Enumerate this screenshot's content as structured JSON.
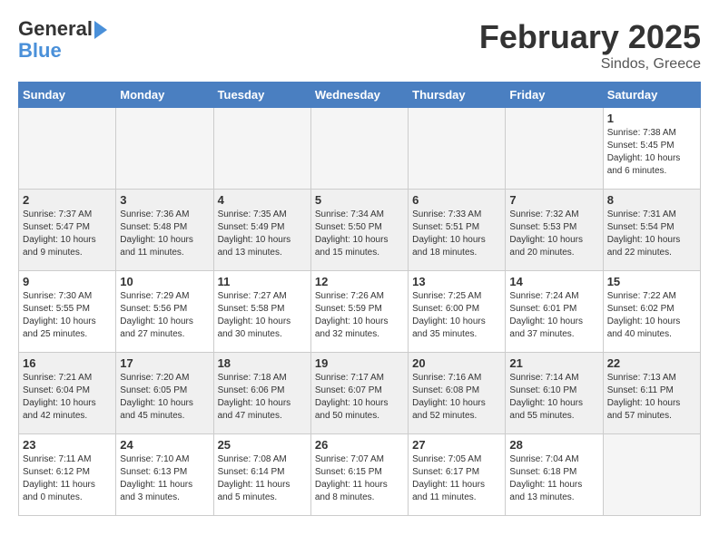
{
  "header": {
    "logo_line1": "General",
    "logo_line2": "Blue",
    "month": "February 2025",
    "location": "Sindos, Greece"
  },
  "weekdays": [
    "Sunday",
    "Monday",
    "Tuesday",
    "Wednesday",
    "Thursday",
    "Friday",
    "Saturday"
  ],
  "weeks": [
    [
      {
        "day": "",
        "info": ""
      },
      {
        "day": "",
        "info": ""
      },
      {
        "day": "",
        "info": ""
      },
      {
        "day": "",
        "info": ""
      },
      {
        "day": "",
        "info": ""
      },
      {
        "day": "",
        "info": ""
      },
      {
        "day": "1",
        "info": "Sunrise: 7:38 AM\nSunset: 5:45 PM\nDaylight: 10 hours and 6 minutes."
      }
    ],
    [
      {
        "day": "2",
        "info": "Sunrise: 7:37 AM\nSunset: 5:47 PM\nDaylight: 10 hours and 9 minutes."
      },
      {
        "day": "3",
        "info": "Sunrise: 7:36 AM\nSunset: 5:48 PM\nDaylight: 10 hours and 11 minutes."
      },
      {
        "day": "4",
        "info": "Sunrise: 7:35 AM\nSunset: 5:49 PM\nDaylight: 10 hours and 13 minutes."
      },
      {
        "day": "5",
        "info": "Sunrise: 7:34 AM\nSunset: 5:50 PM\nDaylight: 10 hours and 15 minutes."
      },
      {
        "day": "6",
        "info": "Sunrise: 7:33 AM\nSunset: 5:51 PM\nDaylight: 10 hours and 18 minutes."
      },
      {
        "day": "7",
        "info": "Sunrise: 7:32 AM\nSunset: 5:53 PM\nDaylight: 10 hours and 20 minutes."
      },
      {
        "day": "8",
        "info": "Sunrise: 7:31 AM\nSunset: 5:54 PM\nDaylight: 10 hours and 22 minutes."
      }
    ],
    [
      {
        "day": "9",
        "info": "Sunrise: 7:30 AM\nSunset: 5:55 PM\nDaylight: 10 hours and 25 minutes."
      },
      {
        "day": "10",
        "info": "Sunrise: 7:29 AM\nSunset: 5:56 PM\nDaylight: 10 hours and 27 minutes."
      },
      {
        "day": "11",
        "info": "Sunrise: 7:27 AM\nSunset: 5:58 PM\nDaylight: 10 hours and 30 minutes."
      },
      {
        "day": "12",
        "info": "Sunrise: 7:26 AM\nSunset: 5:59 PM\nDaylight: 10 hours and 32 minutes."
      },
      {
        "day": "13",
        "info": "Sunrise: 7:25 AM\nSunset: 6:00 PM\nDaylight: 10 hours and 35 minutes."
      },
      {
        "day": "14",
        "info": "Sunrise: 7:24 AM\nSunset: 6:01 PM\nDaylight: 10 hours and 37 minutes."
      },
      {
        "day": "15",
        "info": "Sunrise: 7:22 AM\nSunset: 6:02 PM\nDaylight: 10 hours and 40 minutes."
      }
    ],
    [
      {
        "day": "16",
        "info": "Sunrise: 7:21 AM\nSunset: 6:04 PM\nDaylight: 10 hours and 42 minutes."
      },
      {
        "day": "17",
        "info": "Sunrise: 7:20 AM\nSunset: 6:05 PM\nDaylight: 10 hours and 45 minutes."
      },
      {
        "day": "18",
        "info": "Sunrise: 7:18 AM\nSunset: 6:06 PM\nDaylight: 10 hours and 47 minutes."
      },
      {
        "day": "19",
        "info": "Sunrise: 7:17 AM\nSunset: 6:07 PM\nDaylight: 10 hours and 50 minutes."
      },
      {
        "day": "20",
        "info": "Sunrise: 7:16 AM\nSunset: 6:08 PM\nDaylight: 10 hours and 52 minutes."
      },
      {
        "day": "21",
        "info": "Sunrise: 7:14 AM\nSunset: 6:10 PM\nDaylight: 10 hours and 55 minutes."
      },
      {
        "day": "22",
        "info": "Sunrise: 7:13 AM\nSunset: 6:11 PM\nDaylight: 10 hours and 57 minutes."
      }
    ],
    [
      {
        "day": "23",
        "info": "Sunrise: 7:11 AM\nSunset: 6:12 PM\nDaylight: 11 hours and 0 minutes."
      },
      {
        "day": "24",
        "info": "Sunrise: 7:10 AM\nSunset: 6:13 PM\nDaylight: 11 hours and 3 minutes."
      },
      {
        "day": "25",
        "info": "Sunrise: 7:08 AM\nSunset: 6:14 PM\nDaylight: 11 hours and 5 minutes."
      },
      {
        "day": "26",
        "info": "Sunrise: 7:07 AM\nSunset: 6:15 PM\nDaylight: 11 hours and 8 minutes."
      },
      {
        "day": "27",
        "info": "Sunrise: 7:05 AM\nSunset: 6:17 PM\nDaylight: 11 hours and 11 minutes."
      },
      {
        "day": "28",
        "info": "Sunrise: 7:04 AM\nSunset: 6:18 PM\nDaylight: 11 hours and 13 minutes."
      },
      {
        "day": "",
        "info": ""
      }
    ]
  ]
}
